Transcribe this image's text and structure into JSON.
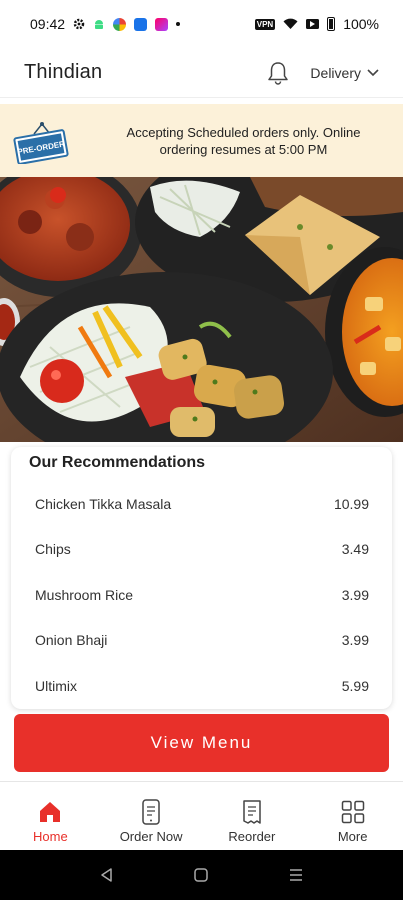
{
  "status_bar": {
    "time": "09:42",
    "vpn": "VPN",
    "battery": "100%"
  },
  "header": {
    "title": "Thindian",
    "delivery_label": "Delivery"
  },
  "banner": {
    "badge": "PRE-ORDER",
    "message": "Accepting Scheduled orders only. Online ordering resumes at 5:00 PM"
  },
  "recommendations": {
    "title": "Our Recommendations",
    "items": [
      {
        "name": "Chicken Tikka Masala",
        "price": "10.99"
      },
      {
        "name": "Chips",
        "price": "3.49"
      },
      {
        "name": "Mushroom Rice",
        "price": "3.99"
      },
      {
        "name": "Onion Bhaji",
        "price": "3.99"
      },
      {
        "name": "Ultimix",
        "price": "5.99"
      }
    ]
  },
  "view_menu_label": "View Menu",
  "bottom_nav": {
    "items": [
      {
        "label": "Home",
        "icon": "home-icon",
        "active": true
      },
      {
        "label": "Order Now",
        "icon": "phone-order-icon",
        "active": false
      },
      {
        "label": "Reorder",
        "icon": "receipt-icon",
        "active": false
      },
      {
        "label": "More",
        "icon": "grid-icon",
        "active": false
      }
    ]
  },
  "colors": {
    "accent": "#e8302a",
    "banner_bg": "#fcf1d9"
  }
}
